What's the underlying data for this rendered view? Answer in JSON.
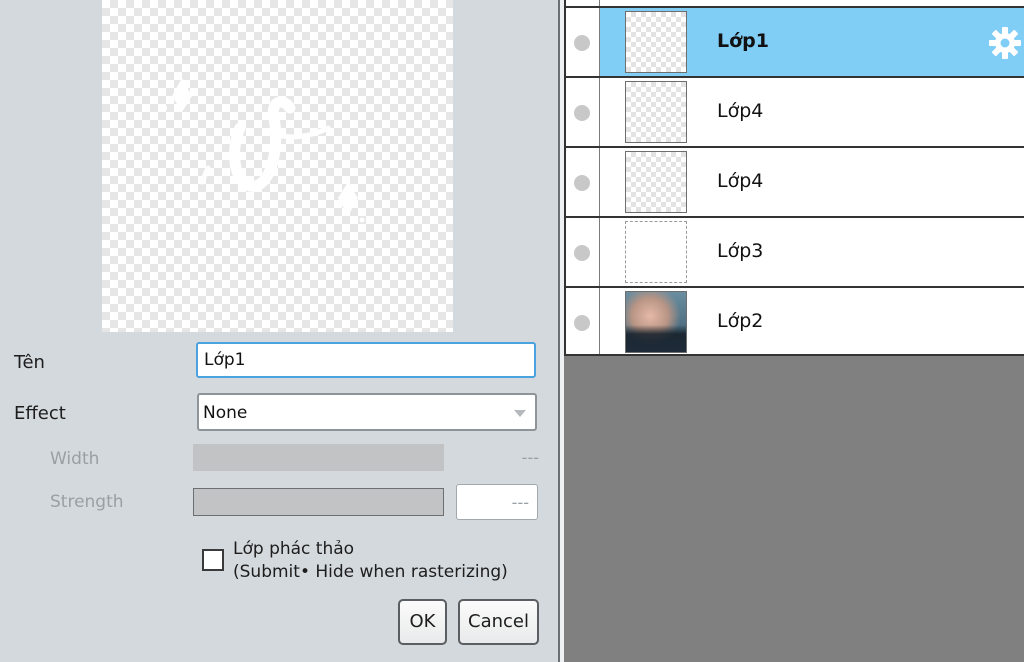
{
  "dialog": {
    "name_label": "Tên",
    "name_value": "Lớp1",
    "effect_label": "Effect",
    "effect_value": "None",
    "width_label": "Width",
    "width_value": "---",
    "strength_label": "Strength",
    "strength_value": "---",
    "draft_label_line1": "Lớp phác thảo",
    "draft_label_line2": "(Submit• Hide when rasterizing)",
    "draft_checked": false,
    "ok_label": "OK",
    "cancel_label": "Cancel"
  },
  "layers": {
    "items": [
      {
        "name": "Lớp1",
        "selected": true,
        "thumb": "checker",
        "visibility_icon": "dot-icon",
        "settings_icon": "gear-icon"
      },
      {
        "name": "Lớp4",
        "selected": false,
        "thumb": "checker",
        "visibility_icon": "dot-icon"
      },
      {
        "name": "Lớp4",
        "selected": false,
        "thumb": "checker",
        "visibility_icon": "dot-icon"
      },
      {
        "name": "Lớp3",
        "selected": false,
        "thumb": "blank",
        "visibility_icon": "dot-icon"
      },
      {
        "name": "Lớp2",
        "selected": false,
        "thumb": "photo",
        "visibility_icon": "dot-icon"
      }
    ]
  },
  "colors": {
    "selected_row": "#80cdf5",
    "input_focus_border": "#4aa3e0",
    "dialog_bg": "#d4d9dd",
    "panel_bg": "#808080"
  }
}
